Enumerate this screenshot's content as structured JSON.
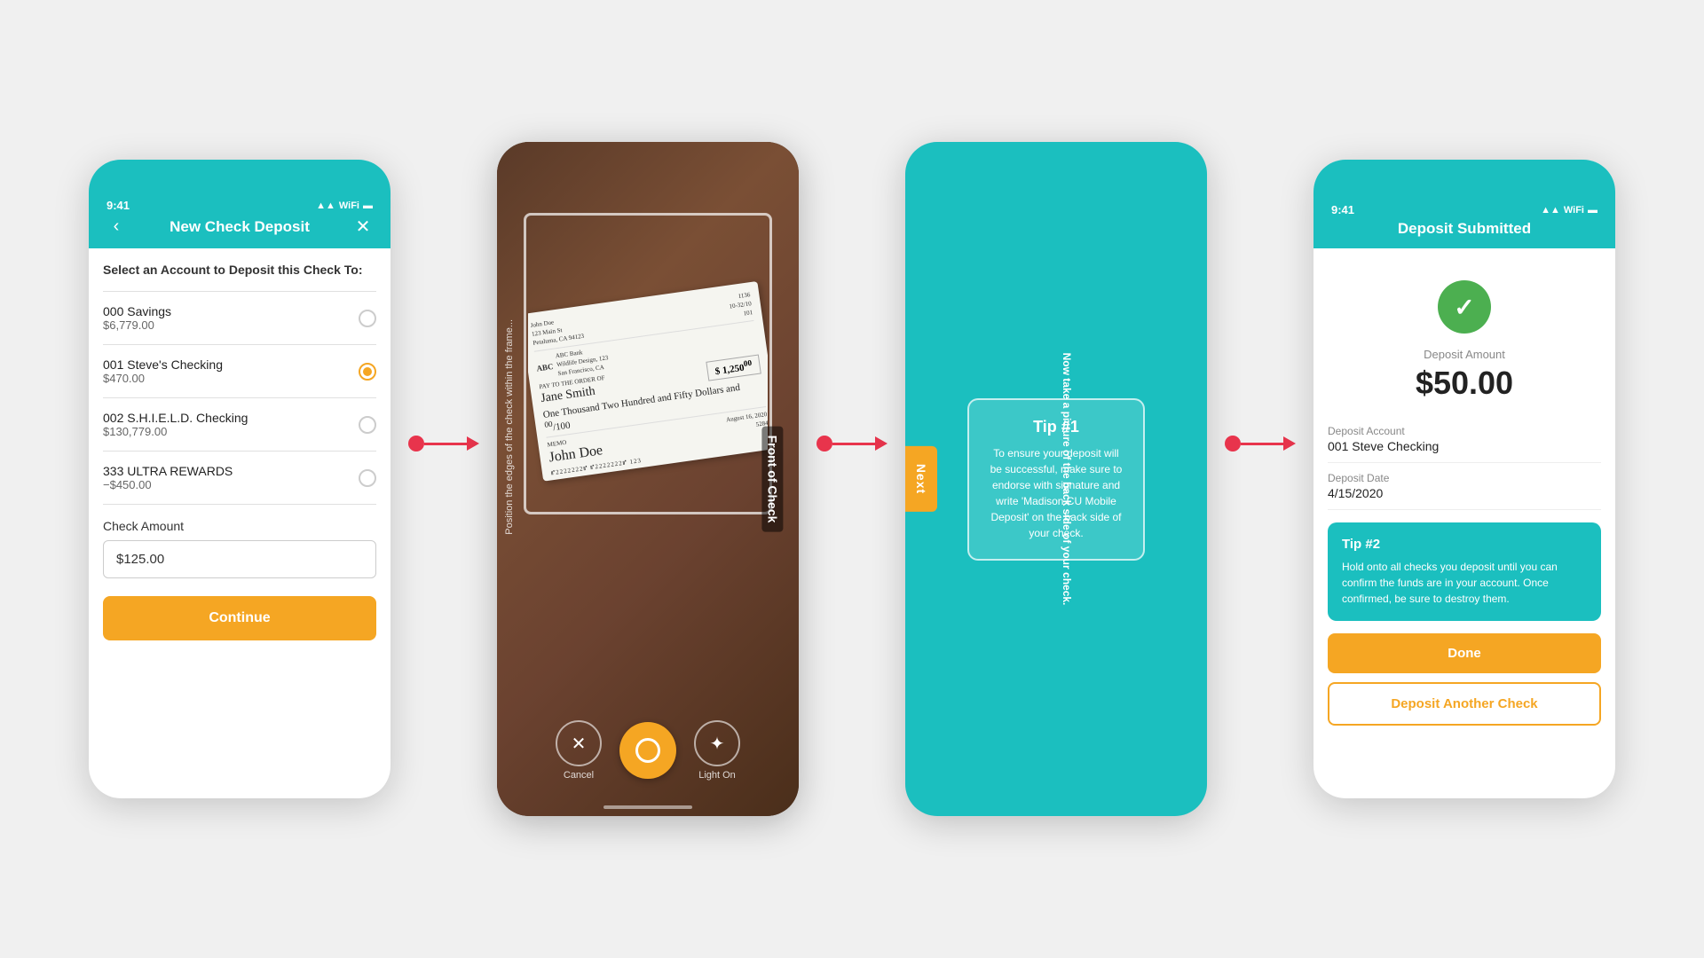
{
  "scene": {
    "background": "#f0f0f0"
  },
  "phone1": {
    "statusBar": {
      "time": "9:41",
      "icons": "▲▲ ⊙ ▬"
    },
    "header": {
      "title": "New Check Deposit",
      "backLabel": "‹",
      "closeLabel": "✕"
    },
    "sectionTitle": "Select an Account to Deposit this Check To:",
    "accounts": [
      {
        "name": "000 Savings",
        "balance": "$6,779.00",
        "selected": false
      },
      {
        "name": "001 Steve's Checking",
        "balance": "$470.00",
        "selected": true
      },
      {
        "name": "002 S.H.I.E.L.D. Checking",
        "balance": "$130,779.00",
        "selected": false
      },
      {
        "name": "333 ULTRA REWARDS",
        "balance": "−$450.00",
        "selected": false
      }
    ],
    "checkAmountLabel": "Check Amount",
    "checkAmountValue": "$125.00",
    "continueLabel": "Continue"
  },
  "phone2": {
    "frontLabel": "Front of Check",
    "positionHint": "Position the edges of the check within the frame...",
    "checkData": {
      "payee": "John Doe",
      "address": "123 Main St",
      "city": "Petaluma, CA 94123",
      "bankName": "ABC Bank",
      "bankAddress": "Wildlife Design, 123\nSan Francisco, CA",
      "payTo": "Jane Smith",
      "amountWords": "One Thousand Two Hundred and Fifty Dollars and 00/100",
      "amount": "$ 1,250 00/100",
      "date": "August 16, 2020",
      "memo": "5284",
      "signature": "John Doe",
      "routingNumbers": "⑈2222222⑈ ⑈2222222⑈ 123"
    },
    "cancelLabel": "Cancel",
    "lightLabel": "Light On",
    "cameraAriaLabel": "Shutter button"
  },
  "phone3": {
    "nextLabel": "Next",
    "backsideText": "Now take a picture of the back side of your check.",
    "tip": {
      "title": "Tip #1",
      "text": "To ensure your deposit will be successful, make sure to endorse with signature and write 'Madison CU Mobile Deposit' on the back side of your check."
    }
  },
  "phone4": {
    "statusBar": {
      "time": "9:41",
      "icons": "▲▲ ⊙ ▬"
    },
    "header": {
      "title": "Deposit Submitted"
    },
    "depositAmountLabel": "Deposit Amount",
    "depositAmountValue": "$50.00",
    "depositAccountLabel": "Deposit Account",
    "depositAccountValue": "001 Steve Checking",
    "depositDateLabel": "Deposit Date",
    "depositDateValue": "4/15/2020",
    "tip2": {
      "title": "Tip #2",
      "text": "Hold onto all checks you deposit until you can confirm the funds are in your account. Once confirmed, be sure to destroy them."
    },
    "doneLabel": "Done",
    "depositAnotherLabel": "Deposit Another Check"
  }
}
